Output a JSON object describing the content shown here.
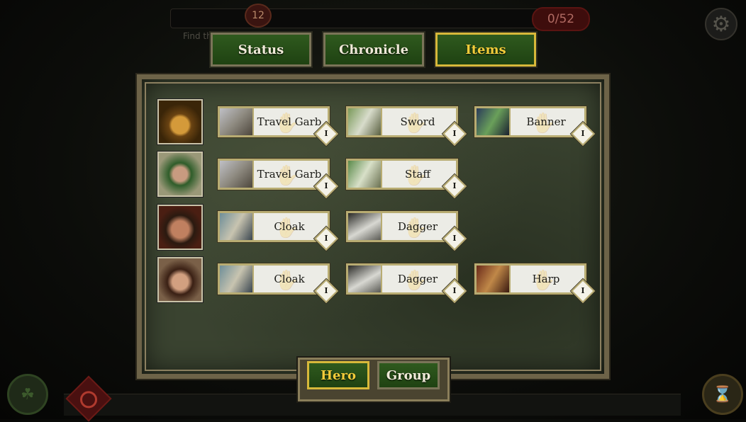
{
  "hud": {
    "level": "12",
    "counter": "0/52",
    "hint": "Find th"
  },
  "tabs": [
    {
      "label": "Status",
      "active": false
    },
    {
      "label": "Chronicle",
      "active": false
    },
    {
      "label": "Items",
      "active": true
    }
  ],
  "heroes": [
    {
      "portrait": "hooded-hero-portrait",
      "items": [
        {
          "name": "Travel Garb",
          "rank": "I",
          "icon": "travel-garb-icon"
        },
        {
          "name": "Sword",
          "rank": "I",
          "icon": "sword-icon"
        },
        {
          "name": "Banner",
          "rank": "I",
          "icon": "banner-icon"
        }
      ]
    },
    {
      "portrait": "green-hood-hero-portrait",
      "items": [
        {
          "name": "Travel Garb",
          "rank": "I",
          "icon": "travel-garb-icon"
        },
        {
          "name": "Staff",
          "rank": "I",
          "icon": "staff-icon"
        }
      ]
    },
    {
      "portrait": "dark-hair-hero-portrait",
      "items": [
        {
          "name": "Cloak",
          "rank": "I",
          "icon": "cloak-icon"
        },
        {
          "name": "Dagger",
          "rank": "I",
          "icon": "dagger-icon"
        }
      ]
    },
    {
      "portrait": "elf-hero-portrait",
      "items": [
        {
          "name": "Cloak",
          "rank": "I",
          "icon": "cloak-icon"
        },
        {
          "name": "Dagger",
          "rank": "I",
          "icon": "dagger-icon"
        },
        {
          "name": "Harp",
          "rank": "I",
          "icon": "harp-icon"
        }
      ]
    }
  ],
  "toggle": [
    {
      "label": "Hero",
      "active": true
    },
    {
      "label": "Group",
      "active": false
    }
  ],
  "colors": {
    "active_tab": "#f2cc3a",
    "tab_fill": "#2f5a1e",
    "panel_bg": "#3a4330",
    "card_bg": "#ecece6"
  }
}
